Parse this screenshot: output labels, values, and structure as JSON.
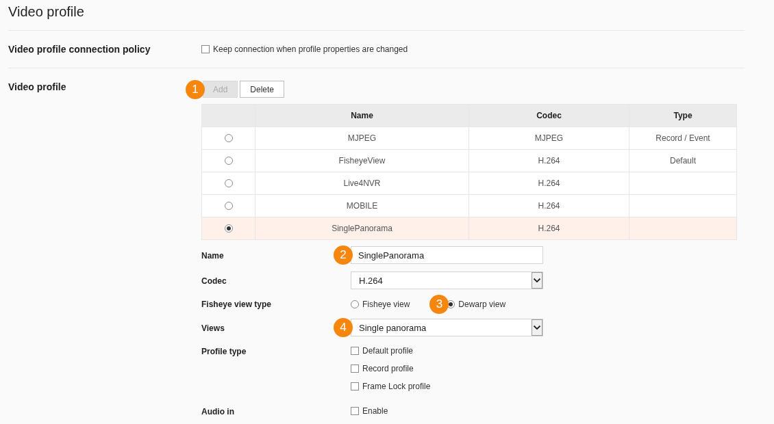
{
  "page": {
    "title": "Video profile"
  },
  "connection_policy": {
    "label": "Video profile connection policy",
    "option": {
      "label": "Keep connection when profile properties are changed",
      "checked": false
    }
  },
  "video_profile": {
    "label": "Video profile",
    "buttons": [
      {
        "label": "Add",
        "disabled": true,
        "callout": "1"
      },
      {
        "label": "Delete",
        "disabled": false
      }
    ],
    "table": {
      "columns": [
        "Name",
        "Codec",
        "Type"
      ],
      "rows": [
        {
          "selected": false,
          "name": "MJPEG",
          "codec": "MJPEG",
          "type": "Record / Event"
        },
        {
          "selected": false,
          "name": "FisheyeView",
          "codec": "H.264",
          "type": "Default"
        },
        {
          "selected": false,
          "name": "Live4NVR",
          "codec": "H.264"
        },
        {
          "selected": false,
          "name": "MOBILE",
          "codec": "H.264"
        },
        {
          "selected": true,
          "name": "SinglePanorama",
          "codec": "H.264"
        }
      ]
    },
    "form": {
      "fields": [
        {
          "kind": "text",
          "label": "Name",
          "value": "SinglePanorama",
          "callout": "2"
        },
        {
          "kind": "select",
          "label": "Codec",
          "value": "H.264"
        },
        {
          "kind": "radio",
          "label": "Fisheye view type",
          "options": [
            {
              "label": "Fisheye view",
              "selected": false
            },
            {
              "label": "Dewarp view",
              "selected": true,
              "callout": "3"
            }
          ]
        },
        {
          "kind": "select",
          "label": "Views",
          "value": "Single panorama",
          "callout": "4"
        },
        {
          "kind": "checkboxes",
          "label": "Profile type",
          "options": [
            {
              "label": "Default profile",
              "checked": false
            },
            {
              "label": "Record profile",
              "checked": false
            },
            {
              "label": "Frame Lock profile",
              "checked": false
            }
          ]
        },
        {
          "kind": "checkboxes",
          "label": "Audio in",
          "options": [
            {
              "label": "Enable",
              "checked": false
            }
          ]
        }
      ]
    }
  }
}
